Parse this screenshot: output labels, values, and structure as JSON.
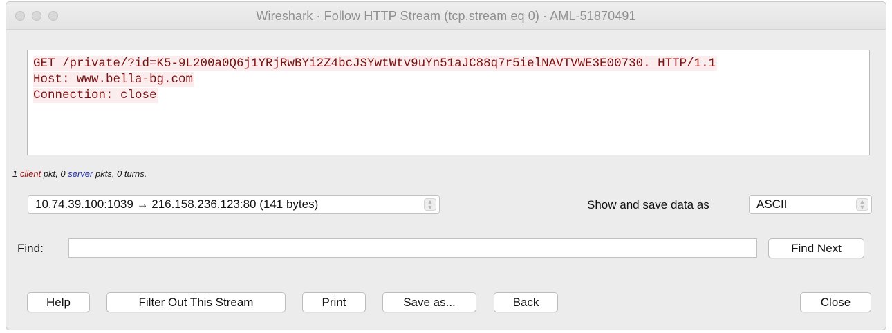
{
  "window": {
    "title": "Wireshark · Follow HTTP Stream (tcp.stream eq 0) · AML-51870491"
  },
  "stream": {
    "lines": [
      "GET /private/?id=K5-9L200a0Q6j1YRjRwBYi2Z4bcJSYwtWtv9uYn51aJC88q7r5ielNAVTVWE3E00730. HTTP/1.1",
      "Host: www.bella-bg.com",
      "Connection: close"
    ],
    "client_text_color": "#7b1010",
    "client_highlight_color": "#fbeded"
  },
  "stats": {
    "count1": "1 ",
    "client": "client",
    "mid": " pkt, 0 ",
    "server": "server",
    "tail": " pkts, 0 turns."
  },
  "conversation_select": {
    "value": "10.74.39.100:1039 → 216.158.236.123:80 (141 bytes)"
  },
  "show_save": {
    "label": "Show and save data as",
    "value": "ASCII"
  },
  "find": {
    "label": "Find:",
    "value": "",
    "next_button": "Find Next"
  },
  "buttons": {
    "help": "Help",
    "filter_out": "Filter Out This Stream",
    "print": "Print",
    "save_as": "Save as...",
    "back": "Back",
    "close": "Close"
  },
  "icons": {
    "window_controls": [
      "close-dot",
      "minimize-dot",
      "zoom-dot"
    ],
    "stepper": "updown-stepper-icon"
  }
}
